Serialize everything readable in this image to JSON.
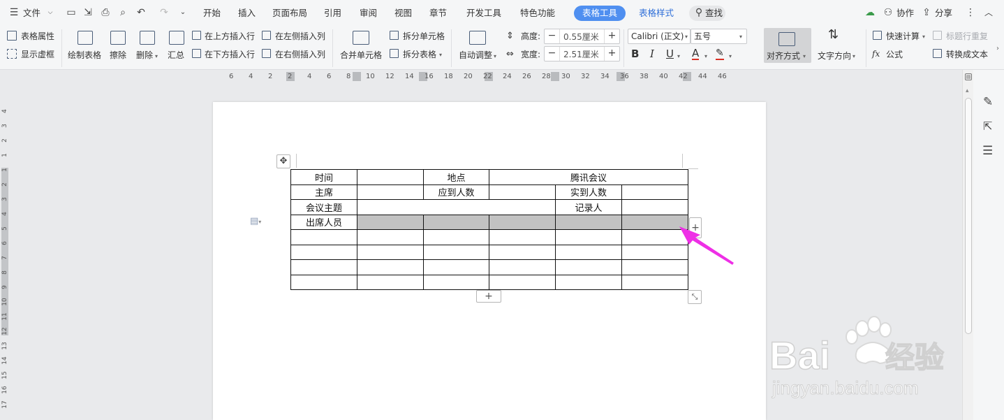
{
  "menubar": {
    "file_label": "文件",
    "tabs": [
      "开始",
      "插入",
      "页面布局",
      "引用",
      "审阅",
      "视图",
      "章节",
      "开发工具",
      "特色功能"
    ],
    "active_tab": "表格工具",
    "next_tab": "表格样式",
    "search_label": "查找",
    "collab_label": "协作",
    "share_label": "分享"
  },
  "ribbon": {
    "table_props": "表格属性",
    "show_grid": "显示虚框",
    "draw_table": "绘制表格",
    "erase": "擦除",
    "delete": "删除",
    "summary": "汇总",
    "insert_above": "在上方插入行",
    "insert_below": "在下方插入行",
    "insert_left": "在左侧插入列",
    "insert_right": "在右侧插入列",
    "merge_cells": "合并单元格",
    "split_cells": "拆分单元格",
    "split_table": "拆分表格",
    "auto_fit": "自动调整",
    "height_label": "高度:",
    "height_value": "0.55厘米",
    "width_label": "宽度:",
    "width_value": "2.51厘米",
    "font_name": "Calibri (正文)",
    "font_size": "五号",
    "align": "对齐方式",
    "text_dir": "文字方向",
    "quick_calc": "快速计算",
    "header_repeat": "标题行重复",
    "formula": "公式",
    "to_text": "转换成文本"
  },
  "ruler": {
    "h_ticks": [
      "6",
      "4",
      "2",
      "2",
      "4",
      "6",
      "8",
      "10",
      "12",
      "14",
      "16",
      "18",
      "20",
      "22",
      "24",
      "26",
      "28",
      "30",
      "32",
      "34",
      "36",
      "38",
      "40",
      "42",
      "44",
      "46"
    ],
    "v_ticks": [
      "4",
      "3",
      "2",
      "1",
      "1",
      "2",
      "3",
      "4",
      "5",
      "6",
      "7",
      "8",
      "9",
      "10",
      "11",
      "12",
      "13",
      "14",
      "15",
      "16",
      "17"
    ]
  },
  "table": {
    "rows": [
      [
        "时间",
        "",
        "地点",
        "腾讯会议"
      ],
      [
        "主席",
        "",
        "应到人数",
        "",
        "实到人数",
        ""
      ],
      [
        "会议主题",
        "",
        "记录人",
        ""
      ],
      [
        "出席人员",
        "",
        "",
        "",
        "",
        ""
      ],
      [
        "",
        "",
        "",
        "",
        "",
        ""
      ],
      [
        "",
        "",
        "",
        "",
        "",
        ""
      ],
      [
        "",
        "",
        "",
        "",
        "",
        ""
      ],
      [
        "",
        "",
        "",
        "",
        "",
        ""
      ]
    ]
  },
  "watermark": {
    "brand_a": "Bai",
    "brand_b": "经验",
    "url": "jingyan.baidu.com"
  },
  "colors": {
    "accent": "#4f8ff0",
    "arrow": "#ee2fe6",
    "selection": "#c2c2c2"
  }
}
